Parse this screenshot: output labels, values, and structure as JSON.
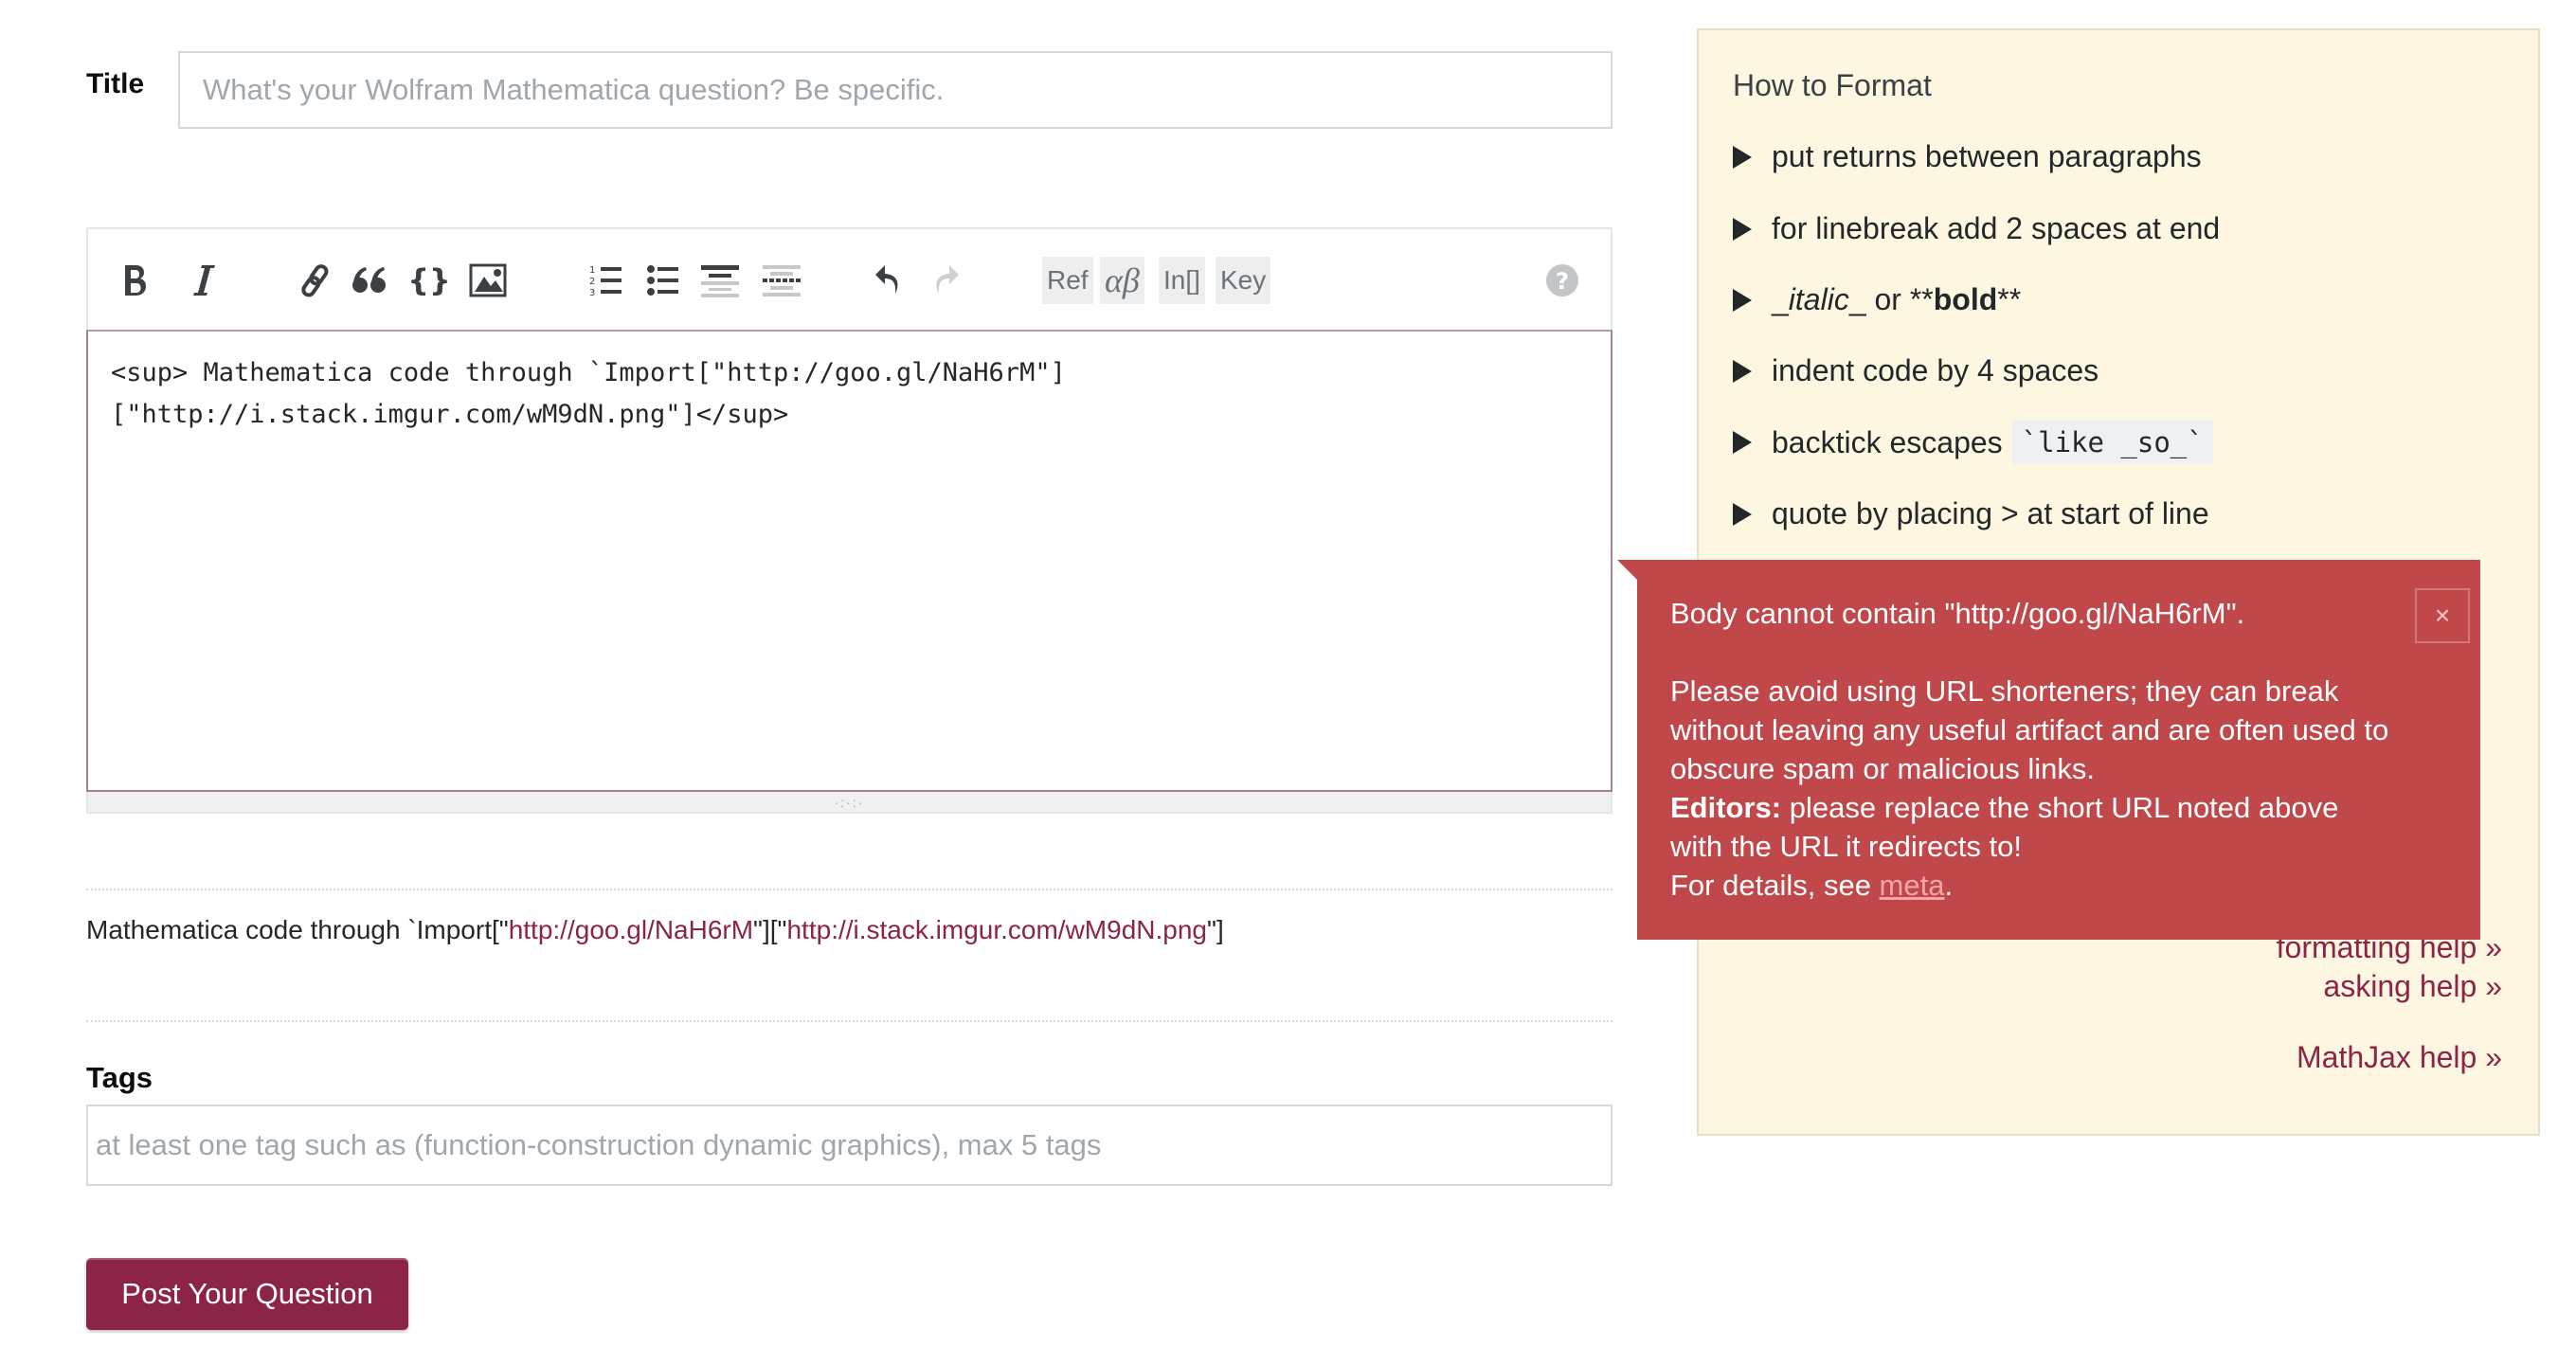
{
  "title": {
    "label": "Title",
    "placeholder": "What's your Wolfram Mathematica question? Be specific.",
    "value": ""
  },
  "editor": {
    "toolbar": {
      "bold": "bold-icon",
      "italic": "italic-icon",
      "link": "link-icon",
      "blockquote": "quote-icon",
      "code": "code-braces-icon",
      "image": "image-icon",
      "ordered_list": "numbered-list-icon",
      "bullet_list": "bulleted-list-icon",
      "heading": "heading-icon",
      "hr": "horizontal-rule-icon",
      "undo": "undo-icon",
      "redo": "redo-icon",
      "ref_label": "Ref",
      "greek_label": "αβ",
      "in_label": "In[]",
      "key_label": "Key",
      "help": "help-icon"
    },
    "value": "<sup> Mathematica code through `Import[\"http://goo.gl/NaH6rM\"]\n[\"http://i.stack.imgur.com/wM9dN.png\"]</sup>\n"
  },
  "preview": {
    "prefix": "Mathematica code through `Import[\"",
    "link1": "http://goo.gl/NaH6rM",
    "middle": "\"][\"",
    "link2": "http://i.stack.imgur.com/wM9dN.png",
    "suffix": "\"]"
  },
  "tags": {
    "label": "Tags",
    "placeholder": "at least one tag such as (function-construction dynamic graphics), max 5 tags"
  },
  "submit": {
    "label": "Post Your Question"
  },
  "sidebar": {
    "title": "How to Format",
    "items": [
      {
        "text": "put returns between paragraphs"
      },
      {
        "text": "for linebreak add 2 spaces at end"
      },
      {
        "italic_pre": "_",
        "italic": "italic",
        "italic_post": "_",
        "mid": " or ",
        "bold_pre": "**",
        "bold": "bold",
        "bold_post": "**"
      },
      {
        "text": "indent code by 4 spaces"
      },
      {
        "text": "backtick escapes",
        "code": "`like _so_`"
      },
      {
        "text": "quote by placing > at start of line"
      }
    ],
    "links": {
      "formatting": "formatting help »",
      "asking": "asking help »",
      "mathjax": "MathJax help »"
    }
  },
  "popup": {
    "heading": "Body cannot contain \"http://goo.gl/NaH6rM\".",
    "line1": "Please avoid using URL shorteners; they can break without leaving any useful artifact and are often used to obscure spam or malicious links.",
    "editors_label": "Editors:",
    "editors_text": " please replace the short URL noted above with the URL it redirects to!",
    "details_prefix": "For details, see ",
    "details_link": "meta",
    "details_suffix": ".",
    "close_label": "×"
  },
  "colors": {
    "brand": "#8c2447",
    "error_bg": "#c0474a",
    "sidebar_bg": "#fdf7e2"
  }
}
